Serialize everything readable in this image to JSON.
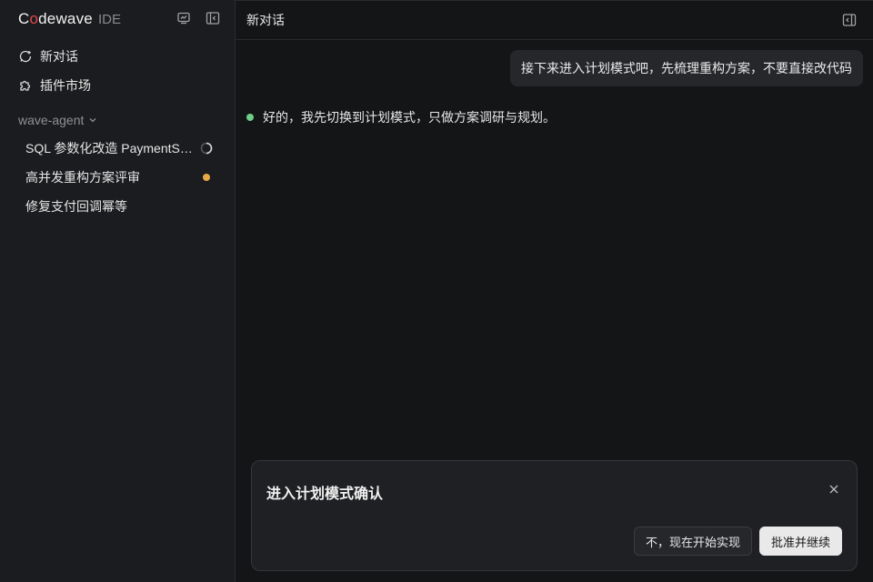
{
  "brand": {
    "name_pre": "C",
    "name_o": "o",
    "name_post": "dewave",
    "suffix": "IDE",
    "accent_color": "#e0484e"
  },
  "sidebar": {
    "nav": [
      {
        "label": "新对话",
        "icon": "new-chat-icon"
      },
      {
        "label": "插件市场",
        "icon": "puzzle-icon"
      }
    ],
    "group": {
      "label": "wave-agent"
    },
    "sessions": [
      {
        "title": "SQL 参数化改造 PaymentService",
        "status": "loading"
      },
      {
        "title": "高并发重构方案评审",
        "status": "unread",
        "status_color": "#e7a84a"
      },
      {
        "title": "修复支付回调幂等",
        "status": "none"
      }
    ]
  },
  "main": {
    "header_title": "新对话",
    "messages": {
      "user": "接下来进入计划模式吧，先梳理重构方案，不要直接改代码",
      "assistant": "好的，我先切换到计划模式，只做方案调研与规划。"
    }
  },
  "dialog": {
    "title": "进入计划模式确认",
    "decline_label": "不，现在开始实现",
    "approve_label": "批准并继续"
  }
}
